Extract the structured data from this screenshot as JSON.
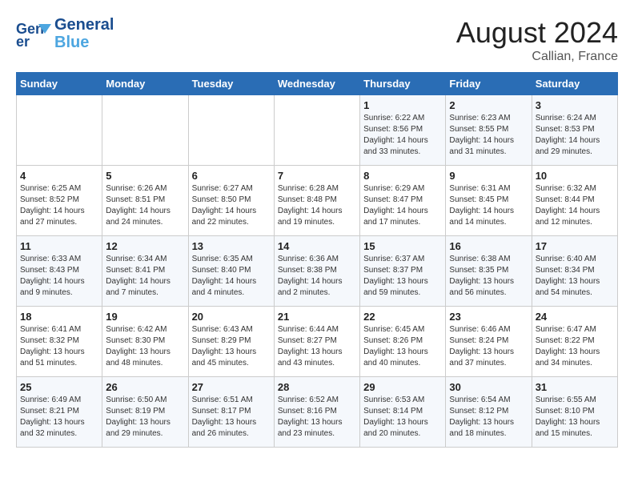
{
  "header": {
    "logo_line1": "General",
    "logo_line2": "Blue",
    "month_year": "August 2024",
    "location": "Callian, France"
  },
  "days_of_week": [
    "Sunday",
    "Monday",
    "Tuesday",
    "Wednesday",
    "Thursday",
    "Friday",
    "Saturday"
  ],
  "weeks": [
    [
      {
        "day": "",
        "content": ""
      },
      {
        "day": "",
        "content": ""
      },
      {
        "day": "",
        "content": ""
      },
      {
        "day": "",
        "content": ""
      },
      {
        "day": "1",
        "content": "Sunrise: 6:22 AM\nSunset: 8:56 PM\nDaylight: 14 hours\nand 33 minutes."
      },
      {
        "day": "2",
        "content": "Sunrise: 6:23 AM\nSunset: 8:55 PM\nDaylight: 14 hours\nand 31 minutes."
      },
      {
        "day": "3",
        "content": "Sunrise: 6:24 AM\nSunset: 8:53 PM\nDaylight: 14 hours\nand 29 minutes."
      }
    ],
    [
      {
        "day": "4",
        "content": "Sunrise: 6:25 AM\nSunset: 8:52 PM\nDaylight: 14 hours\nand 27 minutes."
      },
      {
        "day": "5",
        "content": "Sunrise: 6:26 AM\nSunset: 8:51 PM\nDaylight: 14 hours\nand 24 minutes."
      },
      {
        "day": "6",
        "content": "Sunrise: 6:27 AM\nSunset: 8:50 PM\nDaylight: 14 hours\nand 22 minutes."
      },
      {
        "day": "7",
        "content": "Sunrise: 6:28 AM\nSunset: 8:48 PM\nDaylight: 14 hours\nand 19 minutes."
      },
      {
        "day": "8",
        "content": "Sunrise: 6:29 AM\nSunset: 8:47 PM\nDaylight: 14 hours\nand 17 minutes."
      },
      {
        "day": "9",
        "content": "Sunrise: 6:31 AM\nSunset: 8:45 PM\nDaylight: 14 hours\nand 14 minutes."
      },
      {
        "day": "10",
        "content": "Sunrise: 6:32 AM\nSunset: 8:44 PM\nDaylight: 14 hours\nand 12 minutes."
      }
    ],
    [
      {
        "day": "11",
        "content": "Sunrise: 6:33 AM\nSunset: 8:43 PM\nDaylight: 14 hours\nand 9 minutes."
      },
      {
        "day": "12",
        "content": "Sunrise: 6:34 AM\nSunset: 8:41 PM\nDaylight: 14 hours\nand 7 minutes."
      },
      {
        "day": "13",
        "content": "Sunrise: 6:35 AM\nSunset: 8:40 PM\nDaylight: 14 hours\nand 4 minutes."
      },
      {
        "day": "14",
        "content": "Sunrise: 6:36 AM\nSunset: 8:38 PM\nDaylight: 14 hours\nand 2 minutes."
      },
      {
        "day": "15",
        "content": "Sunrise: 6:37 AM\nSunset: 8:37 PM\nDaylight: 13 hours\nand 59 minutes."
      },
      {
        "day": "16",
        "content": "Sunrise: 6:38 AM\nSunset: 8:35 PM\nDaylight: 13 hours\nand 56 minutes."
      },
      {
        "day": "17",
        "content": "Sunrise: 6:40 AM\nSunset: 8:34 PM\nDaylight: 13 hours\nand 54 minutes."
      }
    ],
    [
      {
        "day": "18",
        "content": "Sunrise: 6:41 AM\nSunset: 8:32 PM\nDaylight: 13 hours\nand 51 minutes."
      },
      {
        "day": "19",
        "content": "Sunrise: 6:42 AM\nSunset: 8:30 PM\nDaylight: 13 hours\nand 48 minutes."
      },
      {
        "day": "20",
        "content": "Sunrise: 6:43 AM\nSunset: 8:29 PM\nDaylight: 13 hours\nand 45 minutes."
      },
      {
        "day": "21",
        "content": "Sunrise: 6:44 AM\nSunset: 8:27 PM\nDaylight: 13 hours\nand 43 minutes."
      },
      {
        "day": "22",
        "content": "Sunrise: 6:45 AM\nSunset: 8:26 PM\nDaylight: 13 hours\nand 40 minutes."
      },
      {
        "day": "23",
        "content": "Sunrise: 6:46 AM\nSunset: 8:24 PM\nDaylight: 13 hours\nand 37 minutes."
      },
      {
        "day": "24",
        "content": "Sunrise: 6:47 AM\nSunset: 8:22 PM\nDaylight: 13 hours\nand 34 minutes."
      }
    ],
    [
      {
        "day": "25",
        "content": "Sunrise: 6:49 AM\nSunset: 8:21 PM\nDaylight: 13 hours\nand 32 minutes."
      },
      {
        "day": "26",
        "content": "Sunrise: 6:50 AM\nSunset: 8:19 PM\nDaylight: 13 hours\nand 29 minutes."
      },
      {
        "day": "27",
        "content": "Sunrise: 6:51 AM\nSunset: 8:17 PM\nDaylight: 13 hours\nand 26 minutes."
      },
      {
        "day": "28",
        "content": "Sunrise: 6:52 AM\nSunset: 8:16 PM\nDaylight: 13 hours\nand 23 minutes."
      },
      {
        "day": "29",
        "content": "Sunrise: 6:53 AM\nSunset: 8:14 PM\nDaylight: 13 hours\nand 20 minutes."
      },
      {
        "day": "30",
        "content": "Sunrise: 6:54 AM\nSunset: 8:12 PM\nDaylight: 13 hours\nand 18 minutes."
      },
      {
        "day": "31",
        "content": "Sunrise: 6:55 AM\nSunset: 8:10 PM\nDaylight: 13 hours\nand 15 minutes."
      }
    ]
  ]
}
